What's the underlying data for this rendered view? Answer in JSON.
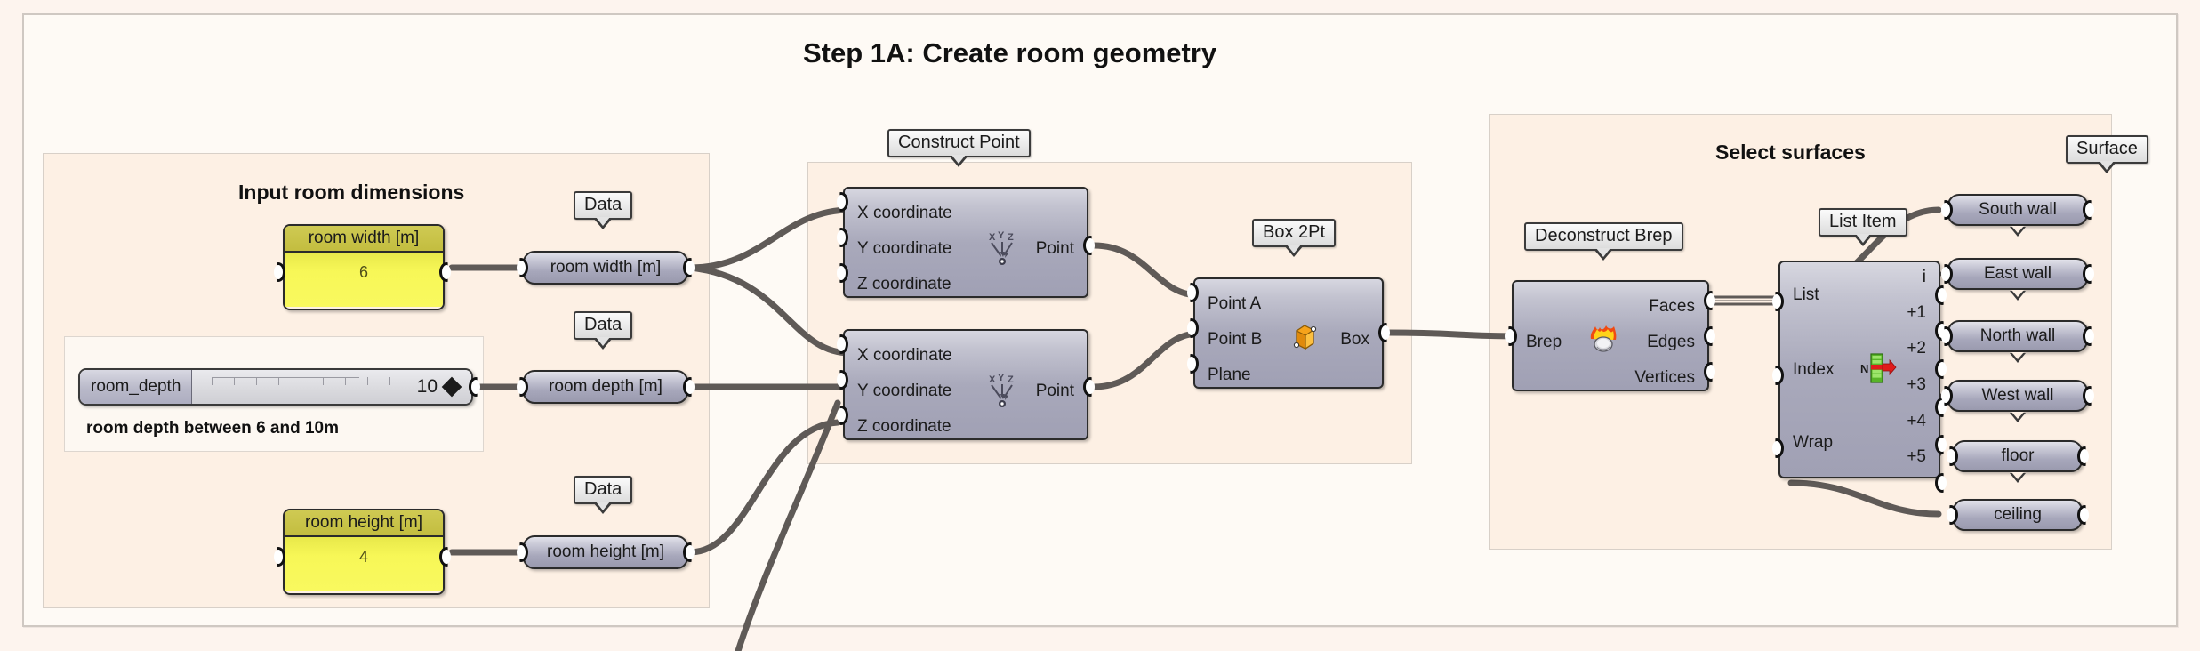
{
  "canvas": {
    "background_color": "#fdf4ee",
    "group_fill": "#fefaf5",
    "group_border": "#cfc8c2"
  },
  "title": "Step 1A: Create room geometry",
  "groups": {
    "input": {
      "title": "Input room dimensions"
    },
    "construct": {
      "title": ""
    },
    "select": {
      "title": "Select surfaces"
    }
  },
  "bubbles": {
    "data_width": "Data",
    "data_depth": "Data",
    "data_height": "Data",
    "construct_point": "Construct Point",
    "box_2pt": "Box 2Pt",
    "deconstruct_brep": "Deconstruct Brep",
    "list_item": "List Item",
    "surface": "Surface"
  },
  "panels": [
    {
      "name": "room-width-panel",
      "header": "room width [m]",
      "value": "6"
    },
    {
      "name": "room-height-panel",
      "header": "room height [m]",
      "value": "4"
    }
  ],
  "slider": {
    "label": "room_depth",
    "value": "10",
    "caption": "room depth between 6 and 10m",
    "min": 6,
    "max": 10,
    "ticks": 11
  },
  "capsules": {
    "room_width": "room width [m]",
    "room_depth": "room depth [m]",
    "room_height": "room height [m]"
  },
  "components": {
    "construct_point_1": {
      "inputs": [
        "X coordinate",
        "Y coordinate",
        "Z coordinate"
      ],
      "outputs": [
        "Point"
      ],
      "icon": "xyz-point-icon"
    },
    "construct_point_2": {
      "inputs": [
        "X coordinate",
        "Y coordinate",
        "Z coordinate"
      ],
      "outputs": [
        "Point"
      ],
      "icon": "xyz-point-icon"
    },
    "box_2pt": {
      "inputs": [
        "Point A",
        "Point B",
        "Plane"
      ],
      "outputs": [
        "Box"
      ],
      "icon": "box-icon"
    },
    "deconstruct_brep": {
      "inputs": [
        "Brep"
      ],
      "outputs": [
        "Faces",
        "Edges",
        "Vertices"
      ],
      "icon": "brep-flame-icon"
    },
    "list_item": {
      "inputs": [
        "List",
        "Index",
        "Wrap"
      ],
      "outputs": [
        "i",
        "+1",
        "+2",
        "+3",
        "+4",
        "+5"
      ],
      "icon": "list-index-icon"
    }
  },
  "surfaces": [
    {
      "name": "south-wall",
      "label": "South wall"
    },
    {
      "name": "east-wall",
      "label": "East wall"
    },
    {
      "name": "north-wall",
      "label": "North wall"
    },
    {
      "name": "west-wall",
      "label": "West wall"
    },
    {
      "name": "floor",
      "label": "floor"
    },
    {
      "name": "ceiling",
      "label": "ceiling"
    }
  ]
}
